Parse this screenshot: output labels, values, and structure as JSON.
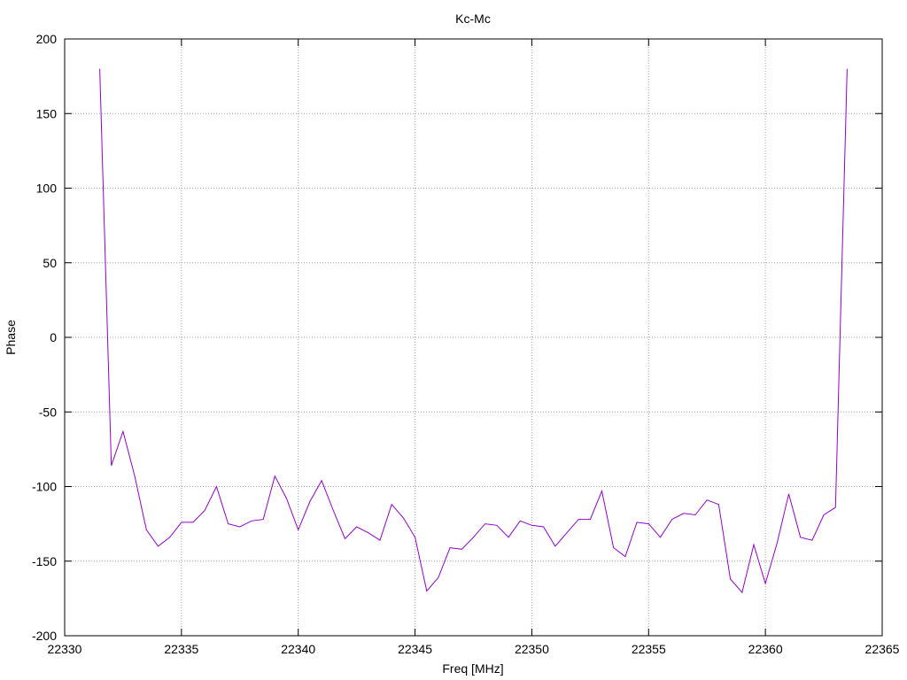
{
  "chart_data": {
    "type": "line",
    "title": "Kc-Mc",
    "xlabel": "Freq [MHz]",
    "ylabel": "Phase",
    "xlim": [
      22330,
      22365
    ],
    "ylim": [
      -200,
      200
    ],
    "xticks": [
      22330,
      22335,
      22340,
      22345,
      22350,
      22355,
      22360,
      22365
    ],
    "yticks": [
      -200,
      -150,
      -100,
      -50,
      0,
      50,
      100,
      150,
      200
    ],
    "grid": true,
    "series": [
      {
        "color": "#9400d3",
        "x": [
          22331.5,
          22332.0,
          22332.5,
          22333.0,
          22333.5,
          22334.0,
          22334.5,
          22335.0,
          22335.5,
          22336.0,
          22336.5,
          22337.0,
          22337.5,
          22338.0,
          22338.5,
          22339.0,
          22339.5,
          22340.0,
          22340.5,
          22341.0,
          22341.5,
          22342.0,
          22342.5,
          22343.0,
          22343.5,
          22344.0,
          22344.5,
          22345.0,
          22345.5,
          22346.0,
          22346.5,
          22347.0,
          22347.5,
          22348.0,
          22348.5,
          22349.0,
          22349.5,
          22350.0,
          22350.5,
          22351.0,
          22351.5,
          22352.0,
          22352.5,
          22353.0,
          22353.5,
          22354.0,
          22354.5,
          22355.0,
          22355.5,
          22356.0,
          22356.5,
          22357.0,
          22357.5,
          22358.0,
          22358.5,
          22359.0,
          22359.5,
          22360.0,
          22360.5,
          22361.0,
          22361.5,
          22362.0,
          22362.5,
          22363.0,
          22363.5
        ],
        "y": [
          180,
          -86,
          -63,
          -93,
          -129,
          -140,
          -134,
          -124,
          -124,
          -116,
          -100,
          -125,
          -127,
          -123,
          -122,
          -93,
          -108,
          -129,
          -110,
          -96,
          -116,
          -135,
          -127,
          -131,
          -136,
          -112,
          -121,
          -134,
          -170,
          -161,
          -141,
          -142,
          -134,
          -125,
          -126,
          -134,
          -123,
          -126,
          -127,
          -140,
          -131,
          -122,
          -122,
          -103,
          -141,
          -147,
          -124,
          -125,
          -134,
          -122,
          -118,
          -119,
          -109,
          -112,
          -162,
          -171,
          -139,
          -165,
          -138,
          -105,
          -134,
          -136,
          -119,
          -114,
          180
        ]
      }
    ]
  }
}
